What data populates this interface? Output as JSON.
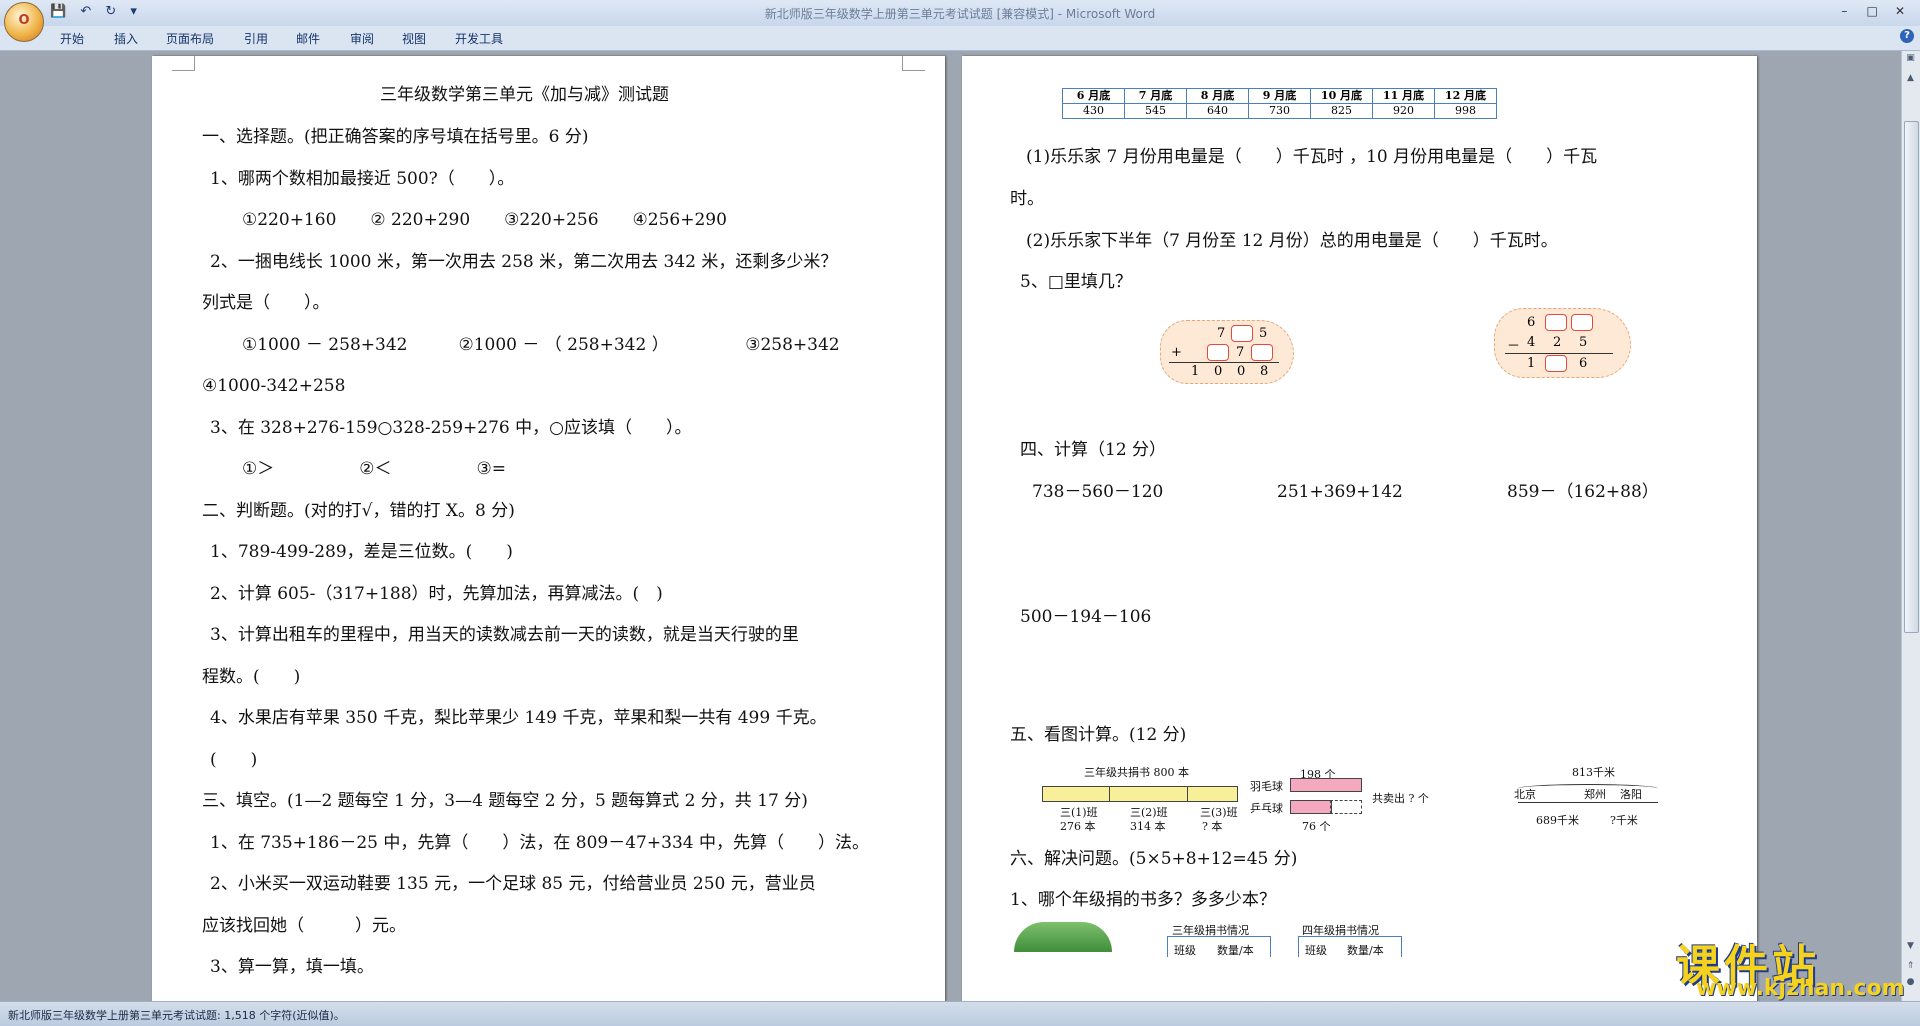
{
  "window": {
    "title": "新北师版三年级数学上册第三单元考试试题 [兼容模式] - Microsoft Word",
    "quick_access": [
      "💾",
      "↶",
      "↻",
      "▾"
    ],
    "controls": [
      "–",
      "□",
      "✕"
    ]
  },
  "ribbon": {
    "tabs": [
      "开始",
      "插入",
      "页面布局",
      "引用",
      "邮件",
      "审阅",
      "视图",
      "开发工具"
    ]
  },
  "status": {
    "text": "新北师版三年级数学上册第三单元考试试题: 1,518 个字符(近似值)。"
  },
  "page1": {
    "title": "三年级数学第三单元《加与减》测试题",
    "lines": [
      "一、选择题。(把正确答案的序号填在括号里。6 分)",
      "1、哪两个数相加最接近 500?（　　）。",
      "①220+160　　②  220+290　　③220+256　　④256+290",
      "2、一捆电线长 1000 米，第一次用去 258 米，第二次用去 342 米，还剩多少米？",
      "列式是（　　）。",
      "①1000 － 258+342　　　②1000 － （ 258+342 ）　　　　　③258+342",
      "④1000-342+258",
      "3、在 328+276-159○328-259+276 中，○应该填（　　）。",
      "①＞　　　　　②＜　　　　　③=",
      "二、判断题。(对的打√，错的打 X。8 分)",
      "1、789-499-289，差是三位数。(　　)",
      "2、计算 605-（317+188）时，先算加法，再算减法。(　)",
      "3、计算出租车的里程中，用当天的读数减去前一天的读数，就是当天行驶的里",
      "程数。(　　)",
      "4、水果店有苹果 350 千克，梨比苹果少 149 千克，苹果和梨一共有 499 千克。",
      "(　　)",
      "三、填空。(1—2 题每空 1 分，3—4 题每空 2 分，5 题每算式 2 分，共 17 分)",
      "1、在 735+186－25 中，先算（　　）法，在 809－47+334 中，先算（　　）法。",
      "2、小米买一双运动鞋要 135 元，一个足球 85 元，付给营业员 250 元，营业员",
      "应该找回她（　　　）元。",
      "3、算一算，填一填。"
    ]
  },
  "page2": {
    "elec_headers": [
      "6 月底",
      "7 月底",
      "8 月底",
      "9 月底",
      "10 月底",
      "11 月底",
      "12 月底"
    ],
    "elec_values": [
      "430",
      "545",
      "640",
      "730",
      "825",
      "920",
      "998"
    ],
    "lines": [
      "(1)乐乐家 7 月份用电量是（　　）千瓦时 ，10 月份用电量是（　　）千瓦",
      "时。",
      "(2)乐乐家下半年（7 月份至 12 月份）总的用电量是（　　）千瓦时。",
      "5、□里填几？",
      "四、计算（12 分）",
      "738－560－120",
      "251+369+142",
      "859－（162+88）",
      "500－194－106",
      "五、看图计算。(12 分)",
      "六、解决问题。(5×5+8+12=45 分)",
      "1、哪个年级捐的书多？多多少本？"
    ],
    "puzzle1": {
      "row1": "7",
      "row1b": "5",
      "row2": "7",
      "op": "+",
      "result": [
        "1",
        "0",
        "0",
        "8"
      ]
    },
    "puzzle2": {
      "row1": "6",
      "row2": [
        "4",
        "2",
        "5"
      ],
      "op": "－",
      "res_a": "1",
      "res_b": "6"
    },
    "fig1": {
      "top": "三年级共捐书 800 本",
      "c1": "三(1)班",
      "c1v": "276 本",
      "c2": "三(2)班",
      "c2v": "314 本",
      "c3": "三(3)班",
      "c3v": "? 本"
    },
    "fig2": {
      "r1": "羽毛球",
      "r2": "乒乓球",
      "v1": "198 个",
      "v2": "76 个",
      "total": "共卖出 ? 个"
    },
    "fig3": {
      "top": "813千米",
      "a": "北京",
      "b": "郑州",
      "c": "洛阳",
      "d1": "689千米",
      "d2": "?千米"
    },
    "tbl_a": {
      "title": "三年级捐书情况",
      "h1": "班级",
      "h2": "数量/本"
    },
    "tbl_b": {
      "title": "四年级捐书情况",
      "h1": "班级",
      "h2": "数量/本"
    }
  },
  "watermark": {
    "cn": "课件站",
    "url": "www.kjzhan.com"
  }
}
